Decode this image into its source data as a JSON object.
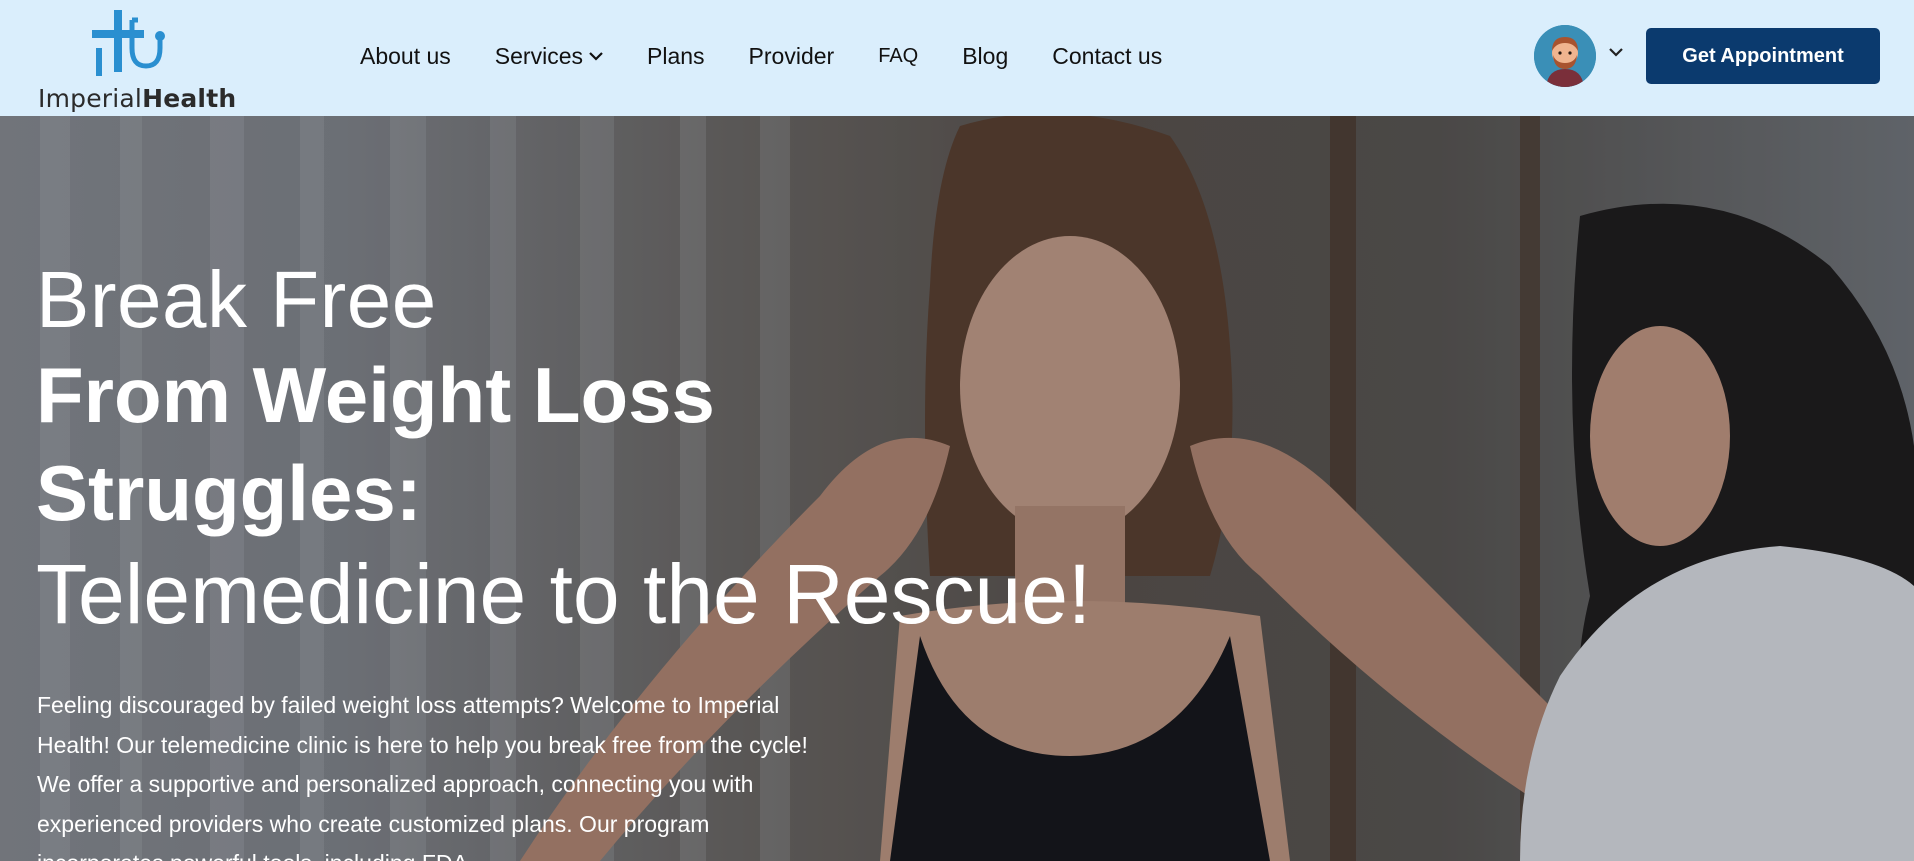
{
  "brand": {
    "name_light": "Imperial",
    "name_bold": "Health",
    "logo_icon": "medical-cross-stethoscope-icon",
    "accent": "#2a8fd0"
  },
  "nav": {
    "items": [
      {
        "label": "About us"
      },
      {
        "label": "Services",
        "has_dropdown": true
      },
      {
        "label": "Plans"
      },
      {
        "label": "Provider"
      },
      {
        "label": "FAQ"
      },
      {
        "label": "Blog"
      },
      {
        "label": "Contact us"
      }
    ]
  },
  "account": {
    "avatar_icon": "user-avatar-icon",
    "dropdown_icon": "chevron-down-icon"
  },
  "cta": {
    "label": "Get Appointment",
    "color": "#0b3a6e"
  },
  "hero": {
    "line1": "Break Free",
    "line2": "From Weight Loss",
    "line3": "Struggles:",
    "line4": "Telemedicine to the Rescue!",
    "intro": "Feeling discouraged by failed weight loss attempts? Welcome to Imperial Health! Our telemedicine clinic is here to help you break free from the cycle! We offer a supportive and personalized approach, connecting you with experienced providers who create customized plans. Our program incorporates powerful tools, including FDA-"
  },
  "colors": {
    "header_bg": "#daeefc",
    "hero_text": "#ffffff"
  }
}
